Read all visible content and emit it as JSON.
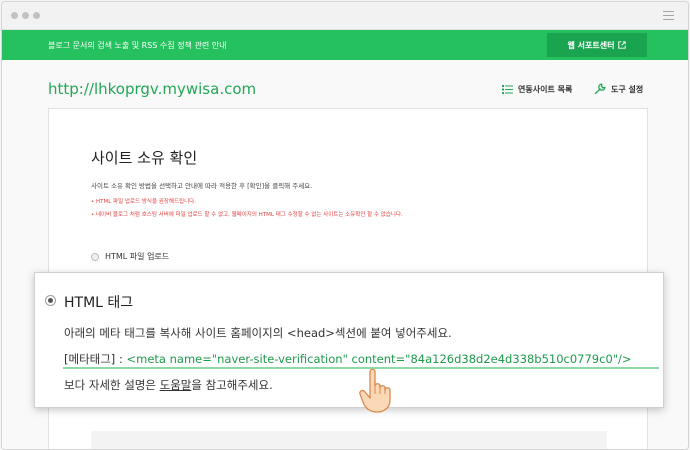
{
  "window": {
    "notice_text": "블로그 문서의 검색 노출 및 RSS 수집 정책 관련 안내",
    "support_button": "웹 서포트센터"
  },
  "header": {
    "site_url": "http://lhkoprgv.mywisa.com",
    "linked_sites": "연동사이트 목록",
    "tools": "도구 설정"
  },
  "card": {
    "title": "사이트 소유 확인",
    "description": "사이트 소유 확인 방법을 선택하고 안내에 따라 적용한 후 [확인]을 클릭해 주세요.",
    "note1": "• HTML 파일 업로드 방식을 권장해드립니다.",
    "note2": "• 네이버 블로그 처럼 호스팅 서버에 파일 업로드 할 수 없고, 웹페이지의 HTML 태그 수정할 수 없는 사이트는 소유확인 할 수 없습니다.",
    "option_file_upload": "HTML 파일 업로드"
  },
  "callout": {
    "option_html_tag": "HTML 태그",
    "instruction": "아래의 메타 태그를 복사해 사이트 홈페이지의 <head>섹션에 붙여 넣어주세요.",
    "meta_label": "[메타태그] : ",
    "meta_tag": "<meta name=\"naver-site-verification\" content=\"84a126d38d2e4d338b510c0779c0\"/>",
    "more_prefix": "보다 자세한 설명은 ",
    "help_link": "도움말",
    "more_suffix": "을 참고해주세요."
  },
  "colors": {
    "brand_green": "#25c15e",
    "dark_green": "#1aa44f",
    "url_green": "#22a756",
    "note_red": "#e64141"
  },
  "icons": {
    "linked_sites": "list-icon",
    "tools": "wrench-icon",
    "support": "external-link-icon",
    "pointer": "pointing-hand-icon"
  }
}
